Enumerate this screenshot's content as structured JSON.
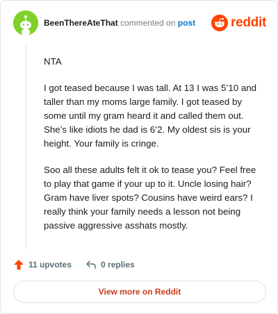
{
  "header": {
    "username": "BeenThereAteThat",
    "action": " commented on ",
    "link": "post",
    "brand": "reddit"
  },
  "comment": {
    "paragraphs": [
      "NTA",
      "I got teased because I was tall. At 13 I was 5’10 and taller than my moms large family. I got teased by some until my gram heard it and called them out. She’s like idiots he dad is 6’2. My oldest sis is your height. Your family is cringe.",
      "Soo all these adults felt it ok to tease you? Feel free to play that game if your up to it. Uncle losing hair? Gram have liver spots? Cousins have weird ears? I really think your family needs a lesson not being passive aggressive asshats mostly."
    ]
  },
  "actions": {
    "upvotes": "11 upvotes",
    "replies": "0 replies"
  },
  "footer": {
    "view_more": "View more on Reddit"
  },
  "colors": {
    "brand": "#ff4500",
    "link": "#0079d3",
    "avatar": "#7fd12a"
  }
}
